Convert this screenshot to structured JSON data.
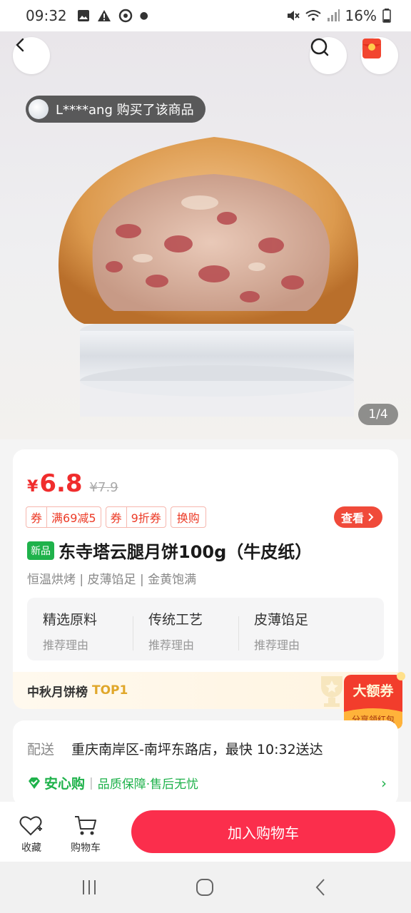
{
  "status_bar": {
    "time": "09:32",
    "battery": "16%"
  },
  "product": {
    "image_counter": "1/4",
    "buyer_notice": "L****ang 购买了该商品",
    "price_symbol": "¥",
    "price": "6.8",
    "original_price": "¥7.9",
    "promos": [
      {
        "prefix": "券",
        "text": "满69减5"
      },
      {
        "prefix": "券",
        "text": "9折券"
      },
      {
        "prefix": "",
        "text": "换购"
      }
    ],
    "view_label": "查看",
    "new_badge": "新品",
    "title": "东寺塔云腿月饼100g（牛皮纸）",
    "features": "恒温烘烤 | 皮薄馅足 | 金黄饱满",
    "reasons": [
      {
        "title": "精选原料",
        "sub": "推荐理由"
      },
      {
        "title": "传统工艺",
        "sub": "推荐理由"
      },
      {
        "title": "皮薄馅足",
        "sub": "推荐理由"
      }
    ],
    "ranking_label": "中秋月饼榜",
    "ranking_rank": "TOP1"
  },
  "coupon_float": {
    "title": "大额券",
    "sub": "分享领红包"
  },
  "delivery": {
    "label": "配送",
    "value": "重庆南岸区-南坪东路店，最快 10:32送达",
    "assurance_brand": "安心购",
    "assurance_desc": "品质保障·售后无忧"
  },
  "bottom_bar": {
    "favorite_label": "收藏",
    "cart_label": "购物车",
    "add_to_cart": "加入购物车"
  },
  "colors": {
    "accent": "#fb2e4c",
    "price": "#f02d2d",
    "green": "#1fb24b",
    "gold": "#e0a72a"
  }
}
